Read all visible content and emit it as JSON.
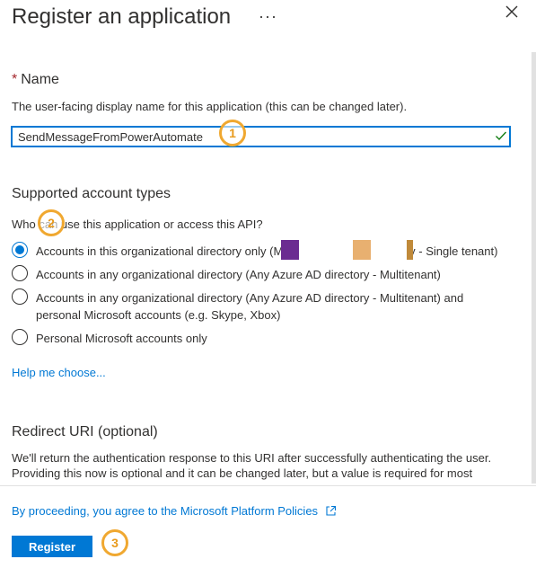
{
  "header": {
    "title": "Register an application",
    "more_label": "···"
  },
  "name_section": {
    "label": "Name",
    "required_mark": "*",
    "description": "The user-facing display name for this application (this can be changed later).",
    "value": "SendMessageFromPowerAutomate"
  },
  "account_types": {
    "title": "Supported account types",
    "question": "Who can use this application or access this API?",
    "options": [
      {
        "label_prefix": "Accounts in this organizational directory only (M",
        "label_suffix": "ly - Single tenant)",
        "checked": true
      },
      {
        "label": "Accounts in any organizational directory (Any Azure AD directory - Multitenant)",
        "checked": false
      },
      {
        "label_line1": "Accounts in any organizational directory (Any Azure AD directory - Multitenant) and",
        "label_line2": "personal Microsoft accounts (e.g. Skype, Xbox)",
        "checked": false
      },
      {
        "label": "Personal Microsoft accounts only",
        "checked": false
      }
    ],
    "help_link": "Help me choose..."
  },
  "redirect": {
    "title": "Redirect URI (optional)",
    "desc_line1": "We'll return the authentication response to this URI after successfully authenticating the user.",
    "desc_line2": "Providing this now is optional and it can be changed later, but a value is required for most"
  },
  "footer": {
    "policy_text": "By proceeding, you agree to the Microsoft Platform Policies",
    "register_label": "Register"
  },
  "callouts": [
    "1",
    "2",
    "3"
  ],
  "colors": {
    "accent": "#0078d4",
    "required": "#a4262c",
    "callout": "#f0a830",
    "redact_purple": "#6b2c91",
    "redact_tan": "#e8b070",
    "redact_brown": "#c08a3a"
  }
}
